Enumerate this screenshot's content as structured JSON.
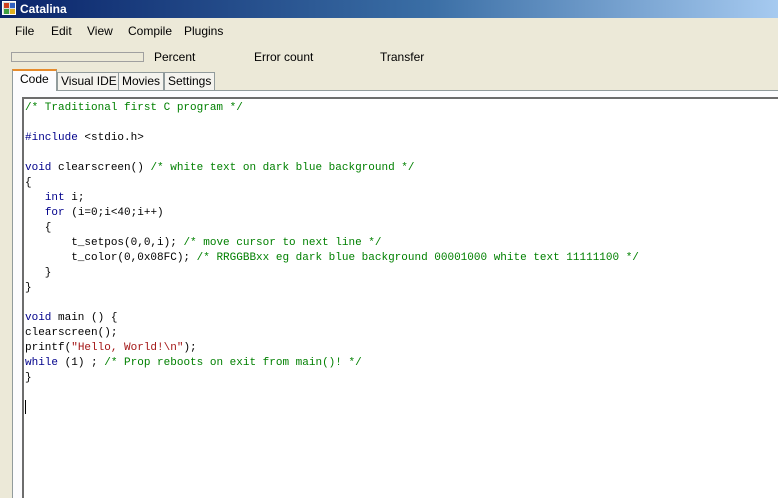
{
  "window": {
    "title": "Catalina"
  },
  "menu": {
    "items": [
      "File",
      "Edit",
      "View",
      "Compile",
      "Plugins"
    ]
  },
  "status": {
    "percent_label": "Percent",
    "error_count_label": "Error count",
    "transfer_label": "Transfer",
    "progress": 0
  },
  "tabs": [
    {
      "label": "Code",
      "active": true
    },
    {
      "label": "Visual IDE",
      "active": false
    },
    {
      "label": "Movies",
      "active": false
    },
    {
      "label": "Settings",
      "active": false
    }
  ],
  "editor": {
    "lines": [
      [
        {
          "t": "/* Traditional first C program */",
          "c": "cm"
        }
      ],
      [],
      [
        {
          "t": "#include",
          "c": "kw"
        },
        {
          "t": " <stdio.h>",
          "c": ""
        }
      ],
      [],
      [
        {
          "t": "void",
          "c": "kw"
        },
        {
          "t": " clearscreen() ",
          "c": ""
        },
        {
          "t": "/* white text on dark blue background */",
          "c": "cm"
        }
      ],
      [
        {
          "t": "{",
          "c": ""
        }
      ],
      [
        {
          "t": "   ",
          "c": ""
        },
        {
          "t": "int",
          "c": "kw"
        },
        {
          "t": " i;",
          "c": ""
        }
      ],
      [
        {
          "t": "   ",
          "c": ""
        },
        {
          "t": "for",
          "c": "kw"
        },
        {
          "t": " (i=0;i<40;i++)",
          "c": ""
        }
      ],
      [
        {
          "t": "   {",
          "c": ""
        }
      ],
      [
        {
          "t": "       t_setpos(0,0,i); ",
          "c": ""
        },
        {
          "t": "/* move cursor to next line */",
          "c": "cm"
        }
      ],
      [
        {
          "t": "       t_color(0,0x08FC); ",
          "c": ""
        },
        {
          "t": "/* RRGGBBxx eg dark blue background 00001000 white text 11111100 */",
          "c": "cm"
        }
      ],
      [
        {
          "t": "   }",
          "c": ""
        }
      ],
      [
        {
          "t": "}",
          "c": ""
        }
      ],
      [],
      [
        {
          "t": "void",
          "c": "kw"
        },
        {
          "t": " main () {",
          "c": ""
        }
      ],
      [
        {
          "t": "clearscreen();",
          "c": ""
        }
      ],
      [
        {
          "t": "printf(",
          "c": ""
        },
        {
          "t": "\"Hello, World!\\n\"",
          "c": "st"
        },
        {
          "t": ");",
          "c": ""
        }
      ],
      [
        {
          "t": "while",
          "c": "kw"
        },
        {
          "t": " (1) ; ",
          "c": ""
        },
        {
          "t": "/* Prop reboots on exit from main()! */",
          "c": "cm"
        }
      ],
      [
        {
          "t": "}",
          "c": ""
        }
      ]
    ]
  }
}
